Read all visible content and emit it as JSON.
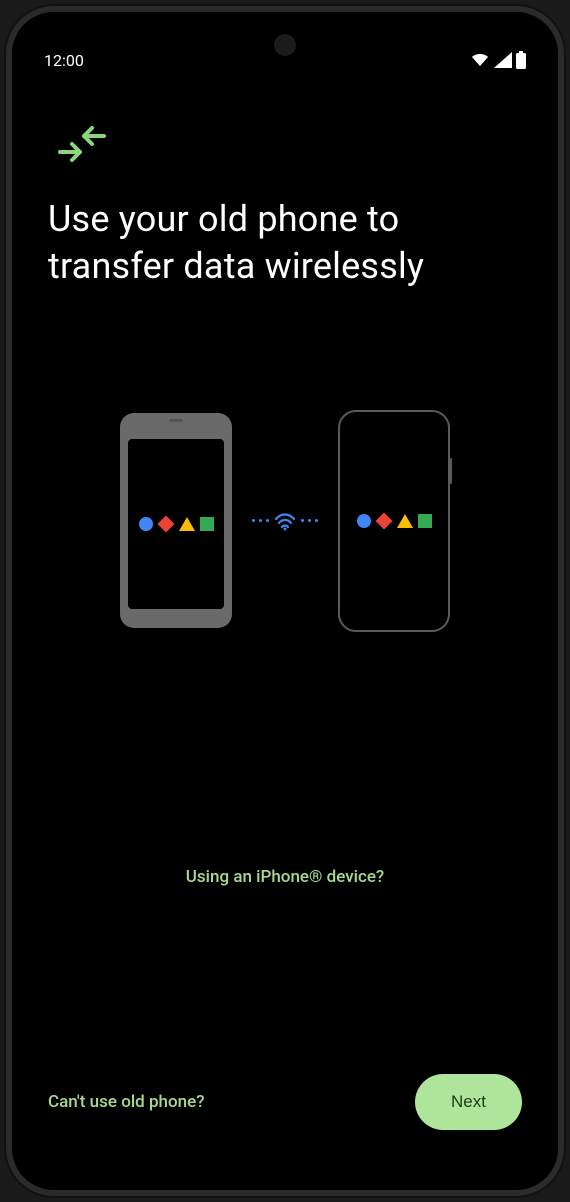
{
  "status": {
    "time": "12:00"
  },
  "headline": "Use your old phone to transfer data wirelessly",
  "links": {
    "iphone": "Using an iPhone® device?",
    "skip": "Can't use old phone?"
  },
  "buttons": {
    "next": "Next"
  }
}
